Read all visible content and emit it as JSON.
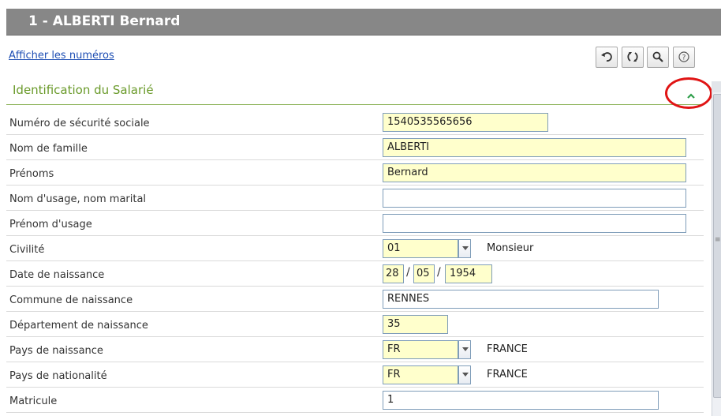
{
  "header": {
    "title": "1 - ALBERTI Bernard"
  },
  "toolbar": {
    "show_numbers_link": "Afficher les numéros",
    "buttons": [
      "undo-icon",
      "refresh-icon",
      "search-icon",
      "help-icon"
    ]
  },
  "section": {
    "title": "Identification du Salarié"
  },
  "fields": {
    "nir": {
      "label": "Numéro de sécurité sociale",
      "value": "1540535565656"
    },
    "nom": {
      "label": "Nom de famille",
      "value": "ALBERTI"
    },
    "prenoms": {
      "label": "Prénoms",
      "value": "Bernard"
    },
    "nom_usage": {
      "label": "Nom d'usage, nom marital",
      "value": ""
    },
    "prenom_usage": {
      "label": "Prénom d'usage",
      "value": ""
    },
    "civilite": {
      "label": "Civilité",
      "value": "01",
      "text": "Monsieur"
    },
    "date_naissance": {
      "label": "Date de naissance",
      "day": "28",
      "month": "05",
      "year": "1954",
      "separator": "/"
    },
    "commune_naissance": {
      "label": "Commune de naissance",
      "value": "RENNES"
    },
    "departement_naissance": {
      "label": "Département de naissance",
      "value": "35"
    },
    "pays_naissance": {
      "label": "Pays de naissance",
      "value": "FR",
      "text": "FRANCE"
    },
    "pays_nationalite": {
      "label": "Pays de nationalité",
      "value": "FR",
      "text": "FRANCE"
    },
    "matricule": {
      "label": "Matricule",
      "value": "1"
    }
  },
  "colors": {
    "accent_green": "#6a9a2a",
    "header_gray": "#878787",
    "field_yellow": "#ffffcc",
    "highlight_red": "#e01414"
  }
}
